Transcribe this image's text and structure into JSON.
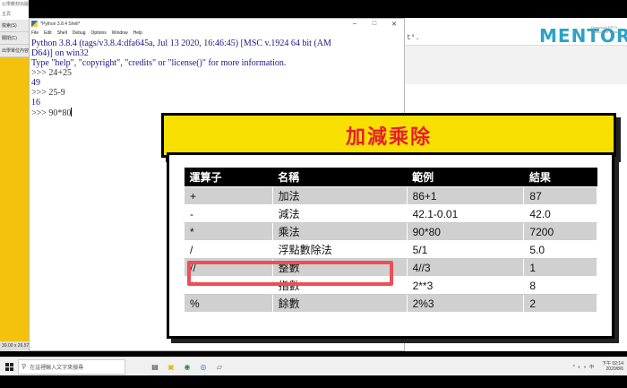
{
  "desktop": {
    "top_title": "公學教材出版 主頁",
    "items": [
      "檢索(S)",
      "關閉(C)",
      "出學單位內容"
    ],
    "status": "30.00 x 26.57 公分"
  },
  "idle": {
    "title": "*Python 3.8.4 Shell*",
    "menu": [
      "File",
      "Edit",
      "Shell",
      "Debug",
      "Options",
      "Window",
      "Help"
    ],
    "lines": [
      {
        "text": "Python 3.8.4 (tags/v3.8.4:dfa645a, Jul 13 2020, 16:46:45) [MSC v.1924 64 bit (AM",
        "kind": "out"
      },
      {
        "text": "D64)] on win32",
        "kind": "out"
      },
      {
        "text": "Type \"help\", \"copyright\", \"credits\" or \"license()\" for more information.",
        "kind": "out"
      },
      {
        "text": ">>> 24+25",
        "kind": "in"
      },
      {
        "text": "49",
        "kind": "res"
      },
      {
        "text": ">>> 25-9",
        "kind": "in"
      },
      {
        "text": "16",
        "kind": "res"
      },
      {
        "text": ">>> 90*80",
        "kind": "in"
      }
    ]
  },
  "background": {
    "fragment": "t°.",
    "logo": "MENTOR",
    "logo_sub": "Download PPTX Classroom Tools"
  },
  "slide": {
    "title": "加減乘除",
    "headers": [
      "運算子",
      "名稱",
      "範例",
      "結果"
    ],
    "rows": [
      [
        "+",
        "加法",
        "86+1",
        "87"
      ],
      [
        "-",
        "減法",
        "42.1-0.01",
        "42.0"
      ],
      [
        "*",
        "乘法",
        "90*80",
        "7200"
      ],
      [
        "/",
        "浮點數除法",
        "5/1",
        "5.0"
      ],
      [
        "//",
        "整數",
        "4//3",
        "1"
      ],
      [
        "**",
        "指數",
        "2**3",
        "8"
      ],
      [
        "%",
        "餘數",
        "2%3",
        "2"
      ]
    ]
  },
  "taskbar": {
    "search_placeholder": "在這裡輸入文字來搜尋",
    "time": "下午 02:14",
    "date": "2020/8/6",
    "sys": "^ ◐ ◗ 中"
  }
}
